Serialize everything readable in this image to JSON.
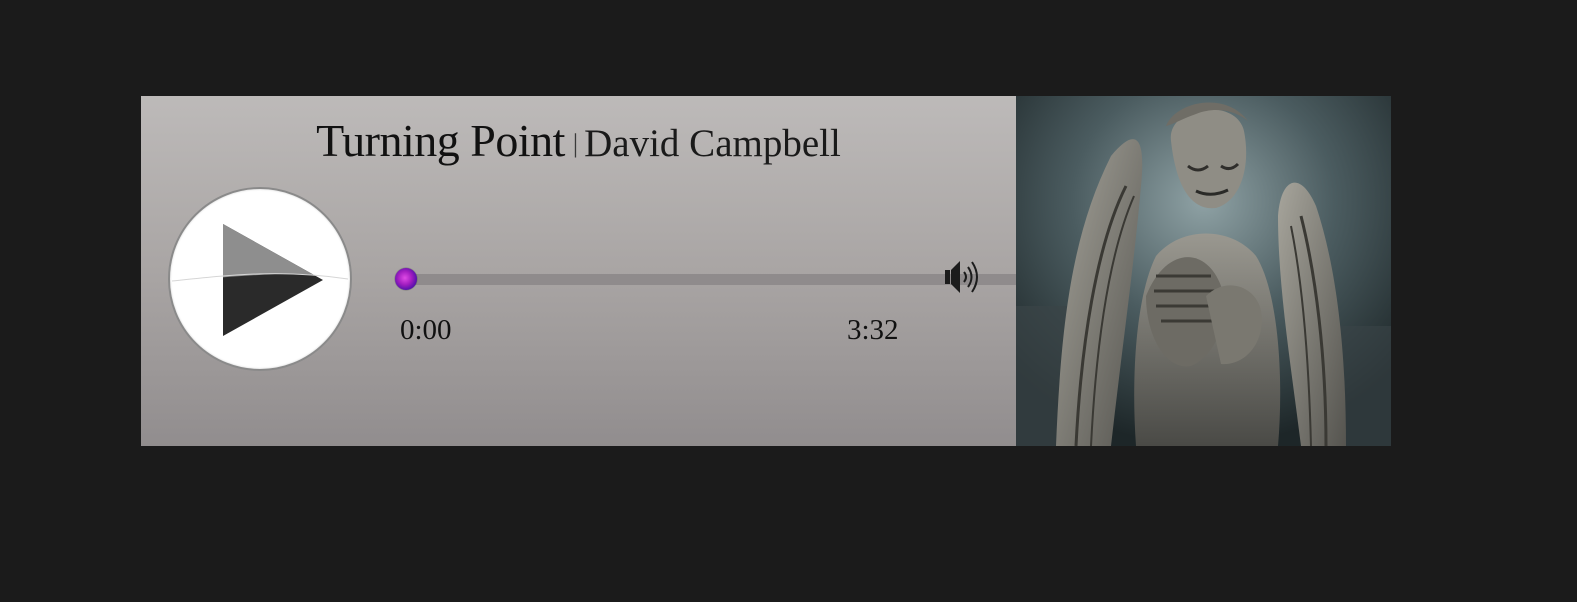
{
  "track": {
    "title": "Turning Point",
    "separator": "|",
    "artist": "David Campbell"
  },
  "playback": {
    "current_time": "0:00",
    "total_time": "3:32",
    "progress": 0.0,
    "state": "paused"
  },
  "icons": {
    "play": "play-icon",
    "volume": "speaker-icon"
  },
  "colors": {
    "background": "#1b1b1b",
    "panel_top": "#bdbab9",
    "panel_bottom": "#918d8e",
    "knob_accent": "#8b1cc4"
  }
}
